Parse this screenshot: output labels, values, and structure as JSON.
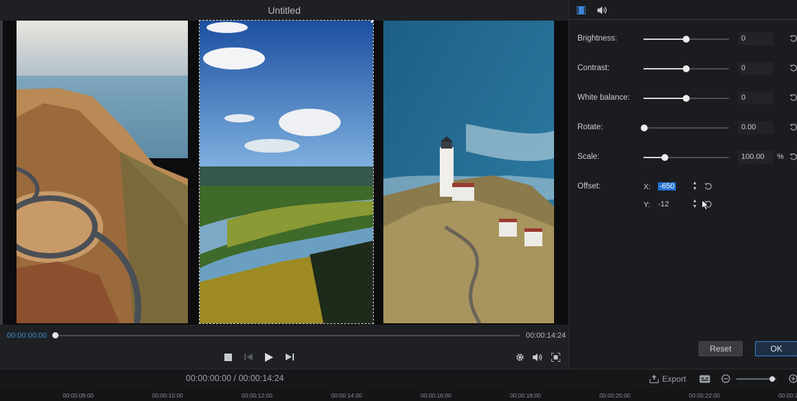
{
  "window": {
    "title": "Untitled"
  },
  "player": {
    "current_time": "00:00:00:00",
    "end_time": "00:00:14:24",
    "progress": 0.0
  },
  "panel": {
    "tabs": [
      "video-tab-icon",
      "audio-tab-icon"
    ],
    "adjustments": [
      {
        "label": "Brightness:",
        "value": "0",
        "level": 0.5
      },
      {
        "label": "Contrast:",
        "value": "0",
        "level": 0.5
      },
      {
        "label": "White balance:",
        "value": "0",
        "level": 0.5
      },
      {
        "label": "Rotate:",
        "value": "0.00",
        "level": 0.0
      },
      {
        "label": "Scale:",
        "value": "100.00",
        "unit": "%",
        "level": 0.25
      }
    ],
    "offset": {
      "label": "Offset:",
      "x_label": "X:",
      "x_value": "-650",
      "y_label": "Y:",
      "y_value": "-12"
    },
    "reset_label": "Reset",
    "ok_label": "OK"
  },
  "timeline": {
    "total_time": "00:00:00:00 / 00:00:14:24",
    "export_label": "Export",
    "ticks": [
      "00:00:08:00",
      "00:00:10:00",
      "00:00:12:00",
      "00:00:14:00",
      "00:00:16:00",
      "00:00:18:00",
      "00:00:20:00",
      "00:00:22:00",
      "00:00:2"
    ]
  },
  "colors": {
    "accent": "#3c86d6",
    "selection": "#1f6fd1",
    "background": "#1c1d20"
  }
}
